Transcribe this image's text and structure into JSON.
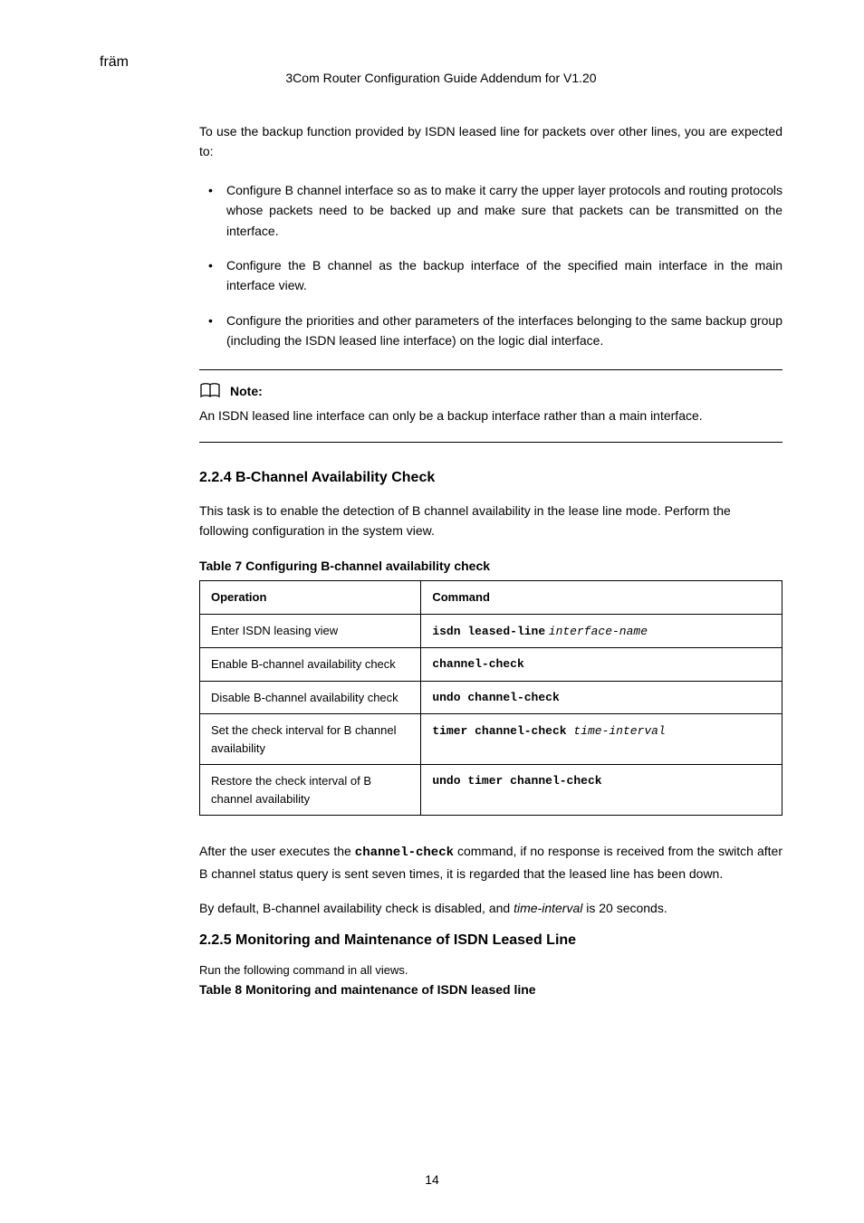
{
  "header": "3Com Router Configuration Guide Addendum for V1.20",
  "intro": "To use the backup function provided by ISDN leased line for packets over other lines, you are expected to:",
  "bullets": [
    "Configure B channel interface so as to make it carry the upper layer protocols and routing protocols whose packets need to be backed up and make sure that packets can be transmitted on the interface.",
    "Configure the B channel as the backup interface of the specified main interface in the main interface view.",
    "Configure the priorities and other parameters of the interfaces belonging to the same backup group (including the ISDN leased line interface) on the logic dial interface."
  ],
  "note": {
    "label": "Note:",
    "text": "An ISDN leased line interface can only be a backup interface rather than a main interface."
  },
  "sections": {
    "channelCheck": {
      "heading": "2.2.4  B-Channel Availability Check",
      "desc1": "This task is to enable the detection of B channel availability in the lease line mode. Perform the following configuration in the system view.",
      "tableTitle": "Table 7 Configuring B-channel availability check",
      "tableHeaders": [
        "Operation",
        "Command"
      ],
      "rows": [
        {
          "op": "Enter ISDN leasing view",
          "cmd": "isdn leased-line interface-name"
        },
        {
          "op": "Enable B-channel availability check",
          "cmd": "channel-check"
        },
        {
          "op": "Disable B-channel availability check",
          "cmd": "undo channel-check"
        },
        {
          "op": "Set the check interval for B channel availability",
          "cmd": "timer channel-check ",
          "cmdItalic": "time-interval"
        },
        {
          "op": "Restore the check interval of B channel availability",
          "cmd": "undo timer channel-check"
        }
      ],
      "postTable1": "After the user executes the ",
      "postTable1b": "channel-check",
      "postTable1c": " command, if no response is received from the switch after B channel status query is sent seven times, it is regarded that the leased line has been down.",
      "postTable2a": "By default, B-channel availability check is disabled, and ",
      "postTable2b": "time-interval",
      "postTable2c": " is 20 seconds."
    },
    "monitoring": {
      "heading": "2.2.5  Monitoring and Maintenance of ISDN Leased Line",
      "runCommand": "Run the following command in all views.",
      "tableTitle": "Table 8 Monitoring and maintenance of ISDN leased line"
    }
  },
  "pageNumber": "14"
}
